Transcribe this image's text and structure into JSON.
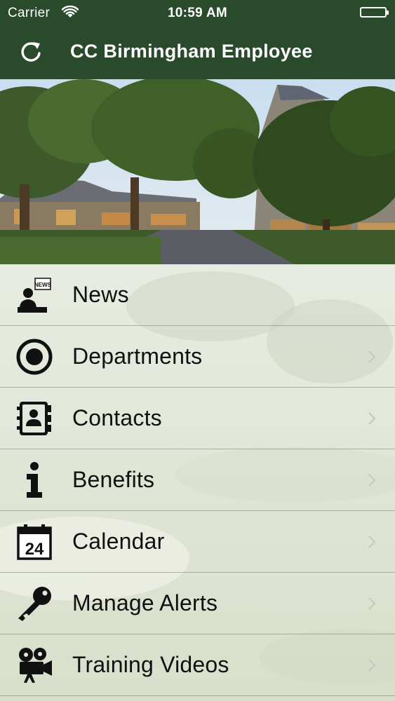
{
  "status_bar": {
    "carrier": "Carrier",
    "time": "10:59 AM",
    "battery_level": 1.0
  },
  "nav": {
    "title": "CC Birmingham Employee",
    "refresh_icon": "refresh-icon"
  },
  "menu": {
    "items": [
      {
        "label": "News",
        "icon": "news-icon",
        "chevron": false
      },
      {
        "label": "Departments",
        "icon": "target-icon",
        "chevron": true
      },
      {
        "label": "Contacts",
        "icon": "address-book-icon",
        "chevron": true
      },
      {
        "label": "Benefits",
        "icon": "info-icon",
        "chevron": true
      },
      {
        "label": "Calendar",
        "icon": "calendar-icon",
        "chevron": true,
        "calendar_day": "24"
      },
      {
        "label": "Manage Alerts",
        "icon": "key-icon",
        "chevron": true
      },
      {
        "label": "Training Videos",
        "icon": "movie-camera-icon",
        "chevron": true
      }
    ]
  },
  "news_icon_badge": "NEWS",
  "colors": {
    "nav_background": "#2a4a2c",
    "nav_text": "#ffffff",
    "menu_text": "#111111"
  }
}
